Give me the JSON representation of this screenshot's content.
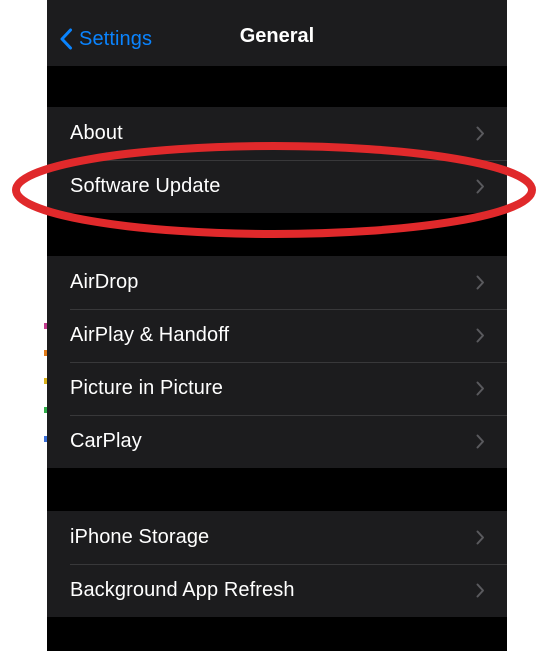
{
  "navbar": {
    "back_label": "Settings",
    "title": "General"
  },
  "groups": [
    {
      "items": [
        {
          "label": "About"
        },
        {
          "label": "Software Update"
        }
      ]
    },
    {
      "items": [
        {
          "label": "AirDrop"
        },
        {
          "label": "AirPlay & Handoff"
        },
        {
          "label": "Picture in Picture"
        },
        {
          "label": "CarPlay"
        }
      ]
    },
    {
      "items": [
        {
          "label": "iPhone Storage"
        },
        {
          "label": "Background App Refresh"
        }
      ]
    }
  ],
  "annotation": {
    "highlight_color": "#e0292b",
    "highlighted_item": "Software Update"
  },
  "colors": {
    "accent": "#0a84ff",
    "cell_background": "#1c1c1e",
    "screen_background": "#000000",
    "chevron": "#5a5a5e"
  },
  "icons": {
    "back": "chevron-left-icon",
    "disclosure": "chevron-right-icon"
  }
}
